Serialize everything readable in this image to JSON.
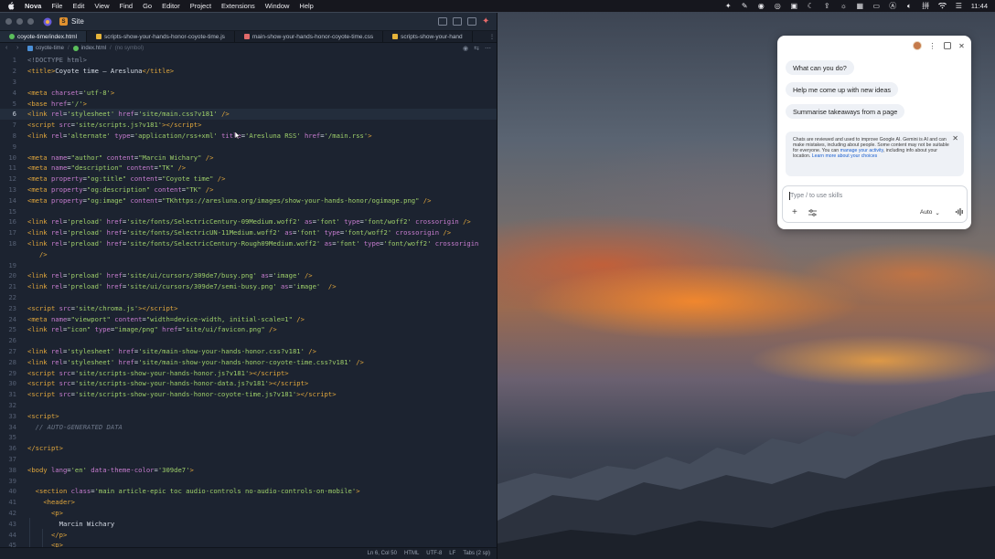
{
  "menubar": {
    "app_name": "Nova",
    "items": [
      "File",
      "Edit",
      "View",
      "Find",
      "Go",
      "Editor",
      "Project",
      "Extensions",
      "Window",
      "Help"
    ],
    "clock": "11:44",
    "status_icons": [
      "nova-spark-icon",
      "script-icon",
      "record-icon",
      "camera-icon",
      "box-icon",
      "moon-icon",
      "upload-icon",
      "brightness-icon",
      "grid-icon",
      "screen-icon",
      "input-method-icon",
      "volume-icon",
      "chinese-input-icon",
      "wifi-icon",
      "control-center-icon"
    ]
  },
  "editor": {
    "project_name": "Site",
    "tabs": [
      {
        "label": "coyote-time/index.html",
        "active": true,
        "color": "#5bbf5b"
      },
      {
        "label": "scripts-show-your-hands-honor-coyote-time.js",
        "active": false,
        "color": "#e6b43a"
      },
      {
        "label": "main-show-your-hands-honor-coyote-time.css",
        "active": false,
        "color": "#e26a6a"
      },
      {
        "label": "scripts-show-your-hand",
        "active": false,
        "color": "#e6b43a"
      }
    ],
    "path": {
      "folder": "coyote-time",
      "file": "index.html",
      "symbol": "(no symbol)"
    },
    "code_lines": [
      {
        "n": "1",
        "html": "<span class='t-doc'>&lt;!DOCTYPE html&gt;</span>"
      },
      {
        "n": "2",
        "html": "<span class='t-tag'>&lt;title&gt;</span>Coyote time — Aresluna<span class='t-tag'>&lt;/title&gt;</span>"
      },
      {
        "n": "3",
        "html": ""
      },
      {
        "n": "4",
        "html": "<span class='t-tag'>&lt;meta</span> <span class='t-attr'>charset</span>=<span class='t-str'>'utf-8'</span><span class='t-tag'>&gt;</span>"
      },
      {
        "n": "5",
        "html": "<span class='t-tag'>&lt;base</span> <span class='t-attr'>href</span>=<span class='t-str'>'/'</span><span class='t-tag'>&gt;</span>"
      },
      {
        "n": "6",
        "html": "<span class='t-tag'>&lt;link</span> <span class='t-attr'>rel</span>=<span class='t-str'>'stylesheet'</span> <span class='t-attr'>href</span>=<span class='t-str'>'site/main.css?v181'</span> <span class='t-tag'>/&gt;</span>",
        "current": true
      },
      {
        "n": "7",
        "html": "<span class='t-tag'>&lt;script</span> <span class='t-attr'>src</span>=<span class='t-str'>'site/scripts.js?v181'</span><span class='t-tag'>&gt;&lt;/script&gt;</span>"
      },
      {
        "n": "8",
        "html": "<span class='t-tag'>&lt;link</span> <span class='t-attr'>rel</span>=<span class='t-str'>'alternate'</span> <span class='t-attr'>type</span>=<span class='t-str'>'application/rss+xml'</span> <span class='t-attr'>title</span>=<span class='t-str'>'Aresluna RSS'</span> <span class='t-attr'>href</span>=<span class='t-str'>'/main.rss'</span><span class='t-tag'>&gt;</span>"
      },
      {
        "n": "9",
        "html": ""
      },
      {
        "n": "10",
        "html": "<span class='t-tag'>&lt;meta</span> <span class='t-attr'>name</span>=<span class='t-str'>\"author\"</span> <span class='t-attr'>content</span>=<span class='t-str'>\"Marcin Wichary\"</span> <span class='t-tag'>/&gt;</span>"
      },
      {
        "n": "11",
        "html": "<span class='t-tag'>&lt;meta</span> <span class='t-attr'>name</span>=<span class='t-str'>\"description\"</span> <span class='t-attr'>content</span>=<span class='t-str'>\"TK\"</span> <span class='t-tag'>/&gt;</span>"
      },
      {
        "n": "12",
        "html": "<span class='t-tag'>&lt;meta</span> <span class='t-attr'>property</span>=<span class='t-str'>\"og:title\"</span> <span class='t-attr'>content</span>=<span class='t-str'>\"Coyote time\"</span> <span class='t-tag'>/&gt;</span>"
      },
      {
        "n": "13",
        "html": "<span class='t-tag'>&lt;meta</span> <span class='t-attr'>property</span>=<span class='t-str'>\"og:description\"</span> <span class='t-attr'>content</span>=<span class='t-str'>\"TK\"</span> <span class='t-tag'>/&gt;</span>"
      },
      {
        "n": "14",
        "html": "<span class='t-tag'>&lt;meta</span> <span class='t-attr'>property</span>=<span class='t-str'>\"og:image\"</span> <span class='t-attr'>content</span>=<span class='t-str'>\"TKhttps://aresluna.org/images/show-your-hands-honor/ogimage.png\"</span> <span class='t-tag'>/&gt;</span>"
      },
      {
        "n": "15",
        "html": ""
      },
      {
        "n": "16",
        "html": "<span class='t-tag'>&lt;link</span> <span class='t-attr'>rel</span>=<span class='t-str'>'preload'</span> <span class='t-attr'>href</span>=<span class='t-str'>'site/fonts/SelectricCentury-09Medium.woff2'</span> <span class='t-attr'>as</span>=<span class='t-str'>'font'</span> <span class='t-attr'>type</span>=<span class='t-str'>'font/woff2'</span> <span class='t-attr'>crossorigin</span> <span class='t-tag'>/&gt;</span>"
      },
      {
        "n": "17",
        "html": "<span class='t-tag'>&lt;link</span> <span class='t-attr'>rel</span>=<span class='t-str'>'preload'</span> <span class='t-attr'>href</span>=<span class='t-str'>'site/fonts/SelectricUN-11Medium.woff2'</span> <span class='t-attr'>as</span>=<span class='t-str'>'font'</span> <span class='t-attr'>type</span>=<span class='t-str'>'font/woff2'</span> <span class='t-attr'>crossorigin</span> <span class='t-tag'>/&gt;</span>"
      },
      {
        "n": "18",
        "html": "<span class='t-tag'>&lt;link</span> <span class='t-attr'>rel</span>=<span class='t-str'>'preload'</span> <span class='t-attr'>href</span>=<span class='t-str'>'site/fonts/SelectricCentury-Rough09Medium.woff2'</span> <span class='t-attr'>as</span>=<span class='t-str'>'font'</span> <span class='t-attr'>type</span>=<span class='t-str'>'font/woff2'</span> <span class='t-attr'>crossorigin</span>"
      },
      {
        "n": "",
        "html": "   <span class='t-tag'>/&gt;</span>"
      },
      {
        "n": "19",
        "html": ""
      },
      {
        "n": "20",
        "html": "<span class='t-tag'>&lt;link</span> <span class='t-attr'>rel</span>=<span class='t-str'>'preload'</span> <span class='t-attr'>href</span>=<span class='t-str'>'site/ui/cursors/309de7/busy.png'</span> <span class='t-attr'>as</span>=<span class='t-str'>'image'</span> <span class='t-tag'>/&gt;</span>"
      },
      {
        "n": "21",
        "html": "<span class='t-tag'>&lt;link</span> <span class='t-attr'>rel</span>=<span class='t-str'>'preload'</span> <span class='t-attr'>href</span>=<span class='t-str'>'site/ui/cursors/309de7/semi-busy.png'</span> <span class='t-attr'>as</span>=<span class='t-str'>'image'</span>  <span class='t-tag'>/&gt;</span>"
      },
      {
        "n": "22",
        "html": ""
      },
      {
        "n": "23",
        "html": "<span class='t-tag'>&lt;script</span> <span class='t-attr'>src</span>=<span class='t-str'>'site/chroma.js'</span><span class='t-tag'>&gt;&lt;/script&gt;</span>"
      },
      {
        "n": "24",
        "html": "<span class='t-tag'>&lt;meta</span> <span class='t-attr'>name</span>=<span class='t-str'>\"viewport\"</span> <span class='t-attr'>content</span>=<span class='t-str'>\"width=device-width, initial-scale=1\"</span> <span class='t-tag'>/&gt;</span>"
      },
      {
        "n": "25",
        "html": "<span class='t-tag'>&lt;link</span> <span class='t-attr'>rel</span>=<span class='t-str'>\"icon\"</span> <span class='t-attr'>type</span>=<span class='t-str'>\"image/png\"</span> <span class='t-attr'>href</span>=<span class='t-str'>\"site/ui/favicon.png\"</span> <span class='t-tag'>/&gt;</span>"
      },
      {
        "n": "26",
        "html": ""
      },
      {
        "n": "27",
        "html": "<span class='t-tag'>&lt;link</span> <span class='t-attr'>rel</span>=<span class='t-str'>'stylesheet'</span> <span class='t-attr'>href</span>=<span class='t-str'>'site/main-show-your-hands-honor.css?v181'</span> <span class='t-tag'>/&gt;</span>"
      },
      {
        "n": "28",
        "html": "<span class='t-tag'>&lt;link</span> <span class='t-attr'>rel</span>=<span class='t-str'>'stylesheet'</span> <span class='t-attr'>href</span>=<span class='t-str'>'site/main-show-your-hands-honor-coyote-time.css?v181'</span> <span class='t-tag'>/&gt;</span>"
      },
      {
        "n": "29",
        "html": "<span class='t-tag'>&lt;script</span> <span class='t-attr'>src</span>=<span class='t-str'>'site/scripts-show-your-hands-honor.js?v181'</span><span class='t-tag'>&gt;&lt;/script&gt;</span>"
      },
      {
        "n": "30",
        "html": "<span class='t-tag'>&lt;script</span> <span class='t-attr'>src</span>=<span class='t-str'>'site/scripts-show-your-hands-honor-data.js?v181'</span><span class='t-tag'>&gt;&lt;/script&gt;</span>"
      },
      {
        "n": "31",
        "html": "<span class='t-tag'>&lt;script</span> <span class='t-attr'>src</span>=<span class='t-str'>'site/scripts-show-your-hands-honor-coyote-time.js?v181'</span><span class='t-tag'>&gt;&lt;/script&gt;</span>"
      },
      {
        "n": "32",
        "html": ""
      },
      {
        "n": "33",
        "html": "<span class='t-tag'>&lt;script&gt;</span>"
      },
      {
        "n": "34",
        "html": "  <span class='t-com'>// AUTO-GENERATED DATA</span>"
      },
      {
        "n": "35",
        "html": ""
      },
      {
        "n": "36",
        "html": "<span class='t-tag'>&lt;/script&gt;</span>"
      },
      {
        "n": "37",
        "html": ""
      },
      {
        "n": "38",
        "html": "<span class='t-tag'>&lt;body</span> <span class='t-attr'>lang</span>=<span class='t-str'>'en'</span> <span class='t-attr'>data-theme-color</span>=<span class='t-str'>'309de7'</span><span class='t-tag'>&gt;</span>"
      },
      {
        "n": "39",
        "html": ""
      },
      {
        "n": "40",
        "html": "  <span class='t-tag'>&lt;section</span> <span class='t-attr'>class</span>=<span class='t-str'>'main article-epic toc audio-controls no-audio-controls-on-mobile'</span><span class='t-tag'>&gt;</span>"
      },
      {
        "n": "41",
        "html": "    <span class='t-tag'>&lt;header&gt;</span>"
      },
      {
        "n": "42",
        "html": "      <span class='t-tag'>&lt;p&gt;</span>"
      },
      {
        "n": "43",
        "html": "        Marcin Wichary"
      },
      {
        "n": "44",
        "html": "      <span class='t-tag'>&lt;/p&gt;</span>"
      },
      {
        "n": "45",
        "html": "      <span class='t-tag'>&lt;p&gt;</span>"
      }
    ],
    "status": {
      "position": "Ln 6, Col 50",
      "language": "HTML",
      "encoding": "UTF-8",
      "line_ending": "LF",
      "indent": "Tabs (2 sp)"
    }
  },
  "gemini": {
    "suggestions": [
      "What can you do?",
      "Help me come up with new ideas",
      "Summarise takeaways from a page"
    ],
    "notice": {
      "text_1": "Chats are reviewed and used to improve Google AI. Gemini is AI and can make mistakes, including about people. Some content may not be suitable for everyone. You can ",
      "link_1": "manage your activity",
      "text_2": ", including info about your location. ",
      "link_2": "Learn more about your choices"
    },
    "input_placeholder": "Type / to use skills",
    "mode": "Auto"
  }
}
